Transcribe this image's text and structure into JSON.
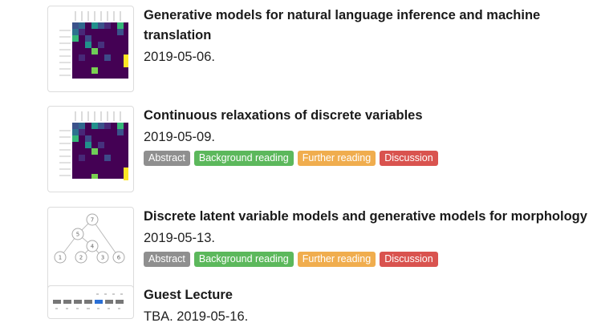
{
  "entries": [
    {
      "title": "Generative models for natural language inference and machine translation",
      "date": "2019-05-06.",
      "thumbnail": "attention-heatmap-thumbnail",
      "badges": []
    },
    {
      "title": "Continuous relaxations of discrete variables",
      "date": "2019-05-09.",
      "thumbnail": "attention-heatmap-thumbnail",
      "badges": [
        {
          "label": "Abstract",
          "color": "#8f8f8f"
        },
        {
          "label": "Background reading",
          "color": "#5cb85c"
        },
        {
          "label": "Further reading",
          "color": "#f0ad4e"
        },
        {
          "label": "Discussion",
          "color": "#d9534f"
        }
      ]
    },
    {
      "title": "Discrete latent variable models and generative models for morphology",
      "date": "2019-05-13.",
      "thumbnail": "tree-graph-thumbnail",
      "graph_nodes": [
        "7",
        "5",
        "4",
        "1",
        "2",
        "3",
        "6"
      ],
      "badges": [
        {
          "label": "Abstract",
          "color": "#8f8f8f"
        },
        {
          "label": "Background reading",
          "color": "#5cb85c"
        },
        {
          "label": "Further reading",
          "color": "#f0ad4e"
        },
        {
          "label": "Discussion",
          "color": "#d9534f"
        }
      ]
    },
    {
      "title": "Guest Lecture",
      "date": "TBA. 2019-05-16.",
      "thumbnail": "sequence-strip-thumbnail",
      "badges": []
    }
  ]
}
